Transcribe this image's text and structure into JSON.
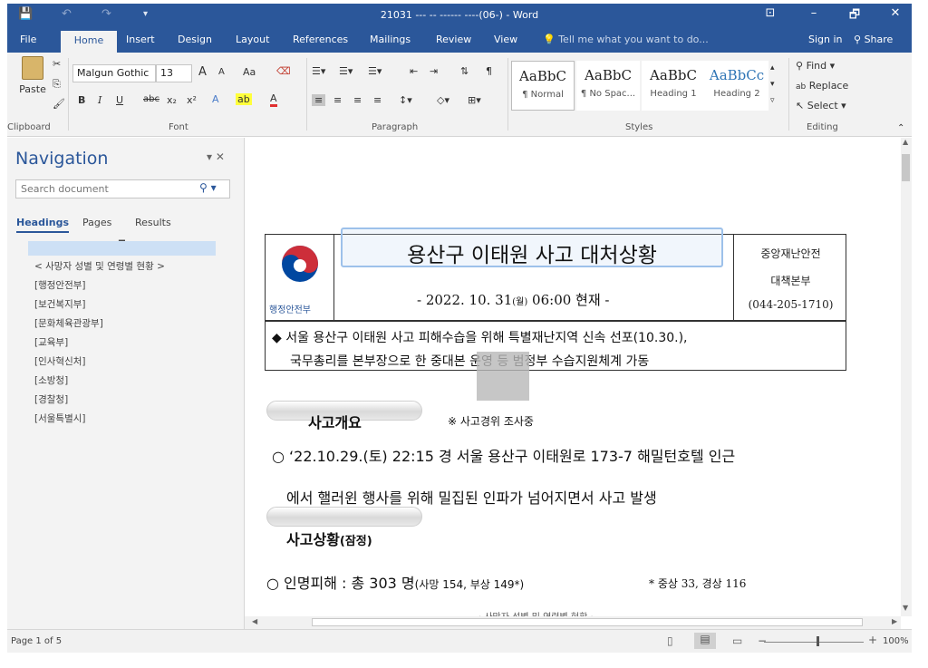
{
  "window": {
    "title": "21031 --- -- ------ ----(06-) - Word",
    "minimize": "–",
    "restore": "🗗",
    "close": "✕",
    "ribbon_display": "⊡"
  },
  "qat": {
    "save": "💾",
    "undo": "↶",
    "redo": "↷",
    "customize": "▾"
  },
  "tabs": [
    "File",
    "Home",
    "Insert",
    "Design",
    "Layout",
    "References",
    "Mailings",
    "Review",
    "View"
  ],
  "tell_me": "Tell me what you want to do...",
  "sign_in": "Sign in",
  "share": "Share",
  "clipboard": {
    "paste": "Paste",
    "group": "Clipboard"
  },
  "font": {
    "name": "Malgun Gothic",
    "size": "13",
    "grow": "A",
    "shrink": "A",
    "case": "Aa",
    "bold": "B",
    "italic": "I",
    "underline": "U",
    "strike": "abc",
    "subscript": "x₂",
    "superscript": "x²",
    "group": "Font"
  },
  "paragraph": {
    "group": "Paragraph",
    "show_marks": "¶"
  },
  "styles": {
    "group": "Styles",
    "items": [
      {
        "sample": "AaBbC",
        "name": "¶ Normal"
      },
      {
        "sample": "AaBbC",
        "name": "¶ No Spac..."
      },
      {
        "sample": "AaBbC",
        "name": "Heading 1"
      },
      {
        "sample": "AaBbCc",
        "name": "Heading 2"
      }
    ]
  },
  "editing": {
    "find": "Find",
    "replace": "Replace",
    "select": "Select",
    "group": "Editing"
  },
  "navigation": {
    "title": "Navigation",
    "search_placeholder": "Search document",
    "tabs": [
      "Headings",
      "Pages",
      "Results"
    ],
    "selected_marker": "▔",
    "items": [
      "< 사망자 성별 및 연령별 현황 >",
      "[행정안전부]",
      "[보건복지부]",
      "[문화체육관광부]",
      "[교육부]",
      "[인사혁신처]",
      "[소방청]",
      "[경찰청]",
      "[서울특별시]"
    ]
  },
  "document": {
    "title": "용산구 이태원 사고 대처상황",
    "date_main": "- 2022. 10. 31",
    "date_day": "(월)",
    "date_time": " 06:00 현재 -",
    "org": "행정안전부",
    "hq_line1": "중앙재난안전",
    "hq_line2": "대책본부",
    "hq_phone": "(044-205-1710)",
    "summary_bullet": "◆",
    "summary_line1": "서울 용산구 이태원 사고 피해수습을 위해 특별재난지역 신속 선포(10.30.),",
    "summary_line2": "국무총리를 본부장으로 한 중대본 운영 등 범정부 수습지원체계 가동",
    "section1_title": "사고개요",
    "section1_note": "※ 사고경위 조사중",
    "section1_line1": "○ ‘22.10.29.(토) 22:15 경 서울 용산구 이태원로 173-7 해밀턴호텔 인근",
    "section1_line2": "에서 핼러윈 행사를 위해 밀집된 인파가 넘어지면서 사고 발생",
    "section2_title": "사고상황",
    "section2_suffix": "(잠정)",
    "casualty_label": "○ 인명피해 : 총 303 명",
    "casualty_detail": "(사망 154, 부상 149*)",
    "casualty_note": "* 중상 33, 경상 116",
    "cut_line": "· 사망자 성별 및 연령별 현황 ·"
  },
  "status": {
    "page": "Page 1 of 5",
    "zoom": "100%"
  },
  "colors": {
    "accent": "#2b579a",
    "logo_red": "#cd2e3a",
    "logo_blue": "#0047a0"
  }
}
